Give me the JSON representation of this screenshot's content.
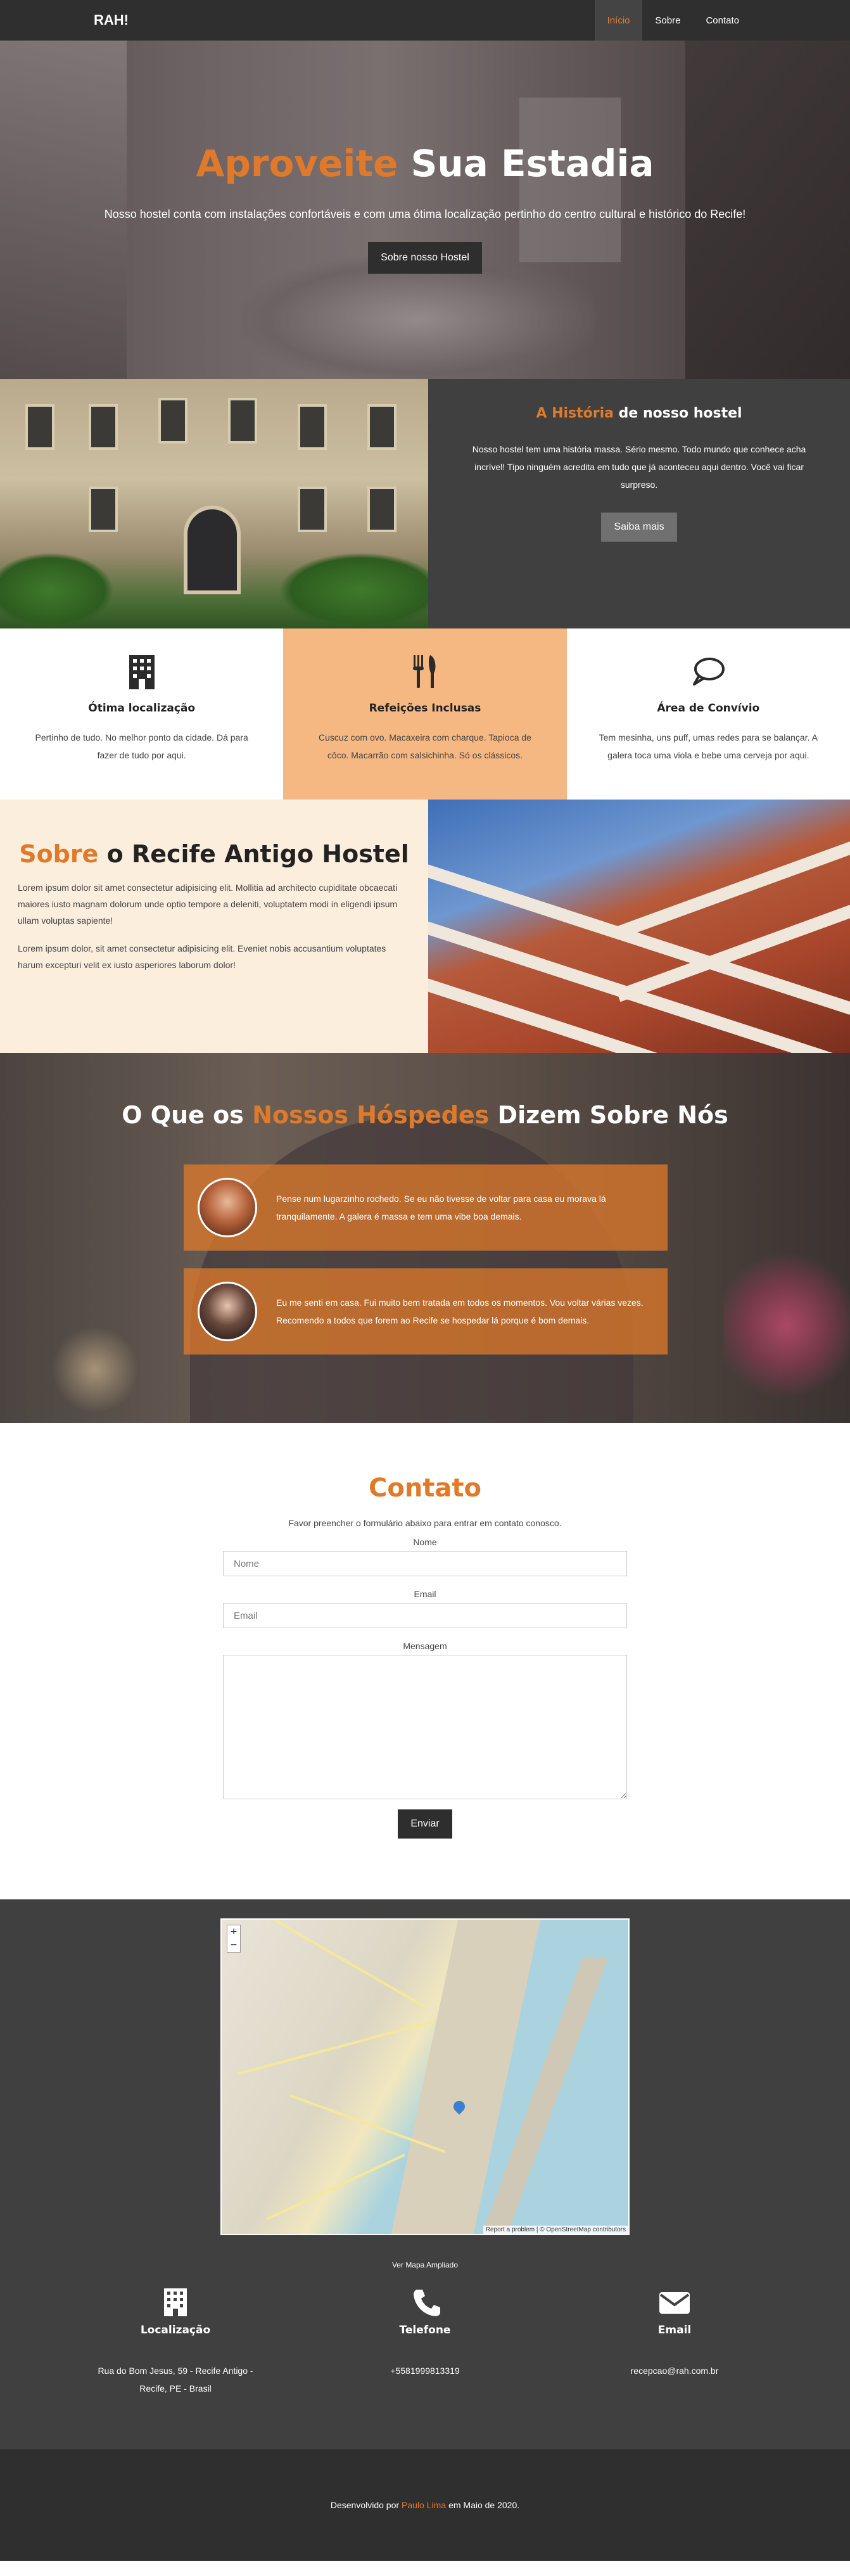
{
  "nav": {
    "brand": "RAH!",
    "links": [
      {
        "label": "Início"
      },
      {
        "label": "Sobre"
      },
      {
        "label": "Contato"
      }
    ]
  },
  "hero": {
    "title_accent": "Aproveite",
    "title_rest": "Sua Estadia",
    "subtitle": "Nosso hostel conta com instalações confortáveis e com uma ótima localização pertinho do centro cultural e histórico do Recife!",
    "button": "Sobre nosso Hostel"
  },
  "history": {
    "title_accent": "A História",
    "title_rest": "de nosso hostel",
    "text": "Nosso hostel tem uma história massa. Sério mesmo. Todo mundo que conhece acha incrível! Tipo ninguém acredita em tudo que já aconteceu aqui dentro. Você vai ficar surpreso.",
    "button": "Saiba mais"
  },
  "features": [
    {
      "icon": "building-icon",
      "title": "Ótima localização",
      "text": "Pertinho de tudo. No melhor ponto da cidade. Dá para fazer de tudo por aqui."
    },
    {
      "icon": "utensils-icon",
      "title": "Refeições Inclusas",
      "text": "Cuscuz com ovo. Macaxeira com charque. Tapioca de côco. Macarrão com salsichinha. Só os clássicos."
    },
    {
      "icon": "chat-bubble-icon",
      "title": "Área de Convívio",
      "text": "Tem mesinha, uns puff, umas redes para se balançar. A galera toca uma viola e bebe uma cerveja por aqui."
    }
  ],
  "about": {
    "title_accent": "Sobre",
    "title_rest": "o Recife Antigo Hostel",
    "paragraphs": [
      "Lorem ipsum dolor sit amet consectetur adipisicing elit. Mollitia ad architecto cupiditate obcaecati maiores iusto magnam dolorum unde optio tempore a deleniti, voluptatem modi in eligendi ipsum ullam voluptas sapiente!",
      "Lorem ipsum dolor, sit amet consectetur adipisicing elit. Eveniet nobis accusantium voluptates harum excepturi velit ex iusto asperiores laborum dolor!"
    ]
  },
  "testimonials": {
    "title_start": "O Que os",
    "title_accent": "Nossos Hóspedes",
    "title_end": "Dizem Sobre Nós",
    "items": [
      {
        "text": "Pense num lugarzinho rochedo. Se eu não tivesse de voltar para casa eu morava lá tranquilamente. A galera é massa e tem uma vibe boa demais."
      },
      {
        "text": "Eu me senti em casa. Fui muito bem tratada em todos os momentos. Vou voltar várias vezes. Recomendo a todos que forem ao Recife se hospedar lá porque é bom demais."
      }
    ]
  },
  "contact": {
    "title": "Contato",
    "intro": "Favor preencher o formulário abaixo para entrar em contato conosco.",
    "name_label": "Nome",
    "name_placeholder": "Nome",
    "email_label": "Email",
    "email_placeholder": "Email",
    "message_label": "Mensagem",
    "button": "Enviar"
  },
  "map": {
    "zoom_in": "+",
    "zoom_out": "−",
    "attribution": "Report a problem | © OpenStreetMap contributors",
    "link": "Ver Mapa Ampliado"
  },
  "info": [
    {
      "icon": "building-icon",
      "title": "Localização",
      "text": "Rua do Bom Jesus, 59 - Recife Antigo - Recife, PE - Brasil"
    },
    {
      "icon": "phone-icon",
      "title": "Telefone",
      "text": "+5581999813319"
    },
    {
      "icon": "envelope-icon",
      "title": "Email",
      "text": "recepcao@rah.com.br"
    }
  ],
  "footer": {
    "prefix": "Desenvolvido por",
    "author": "Paulo Lima",
    "suffix": "em Maio de 2020."
  },
  "colors": {
    "accent": "#e07a2a",
    "dark": "#2f2f2f",
    "panel": "#404040",
    "feature_highlight": "#f6b882",
    "about_bg": "#fbeedd"
  }
}
